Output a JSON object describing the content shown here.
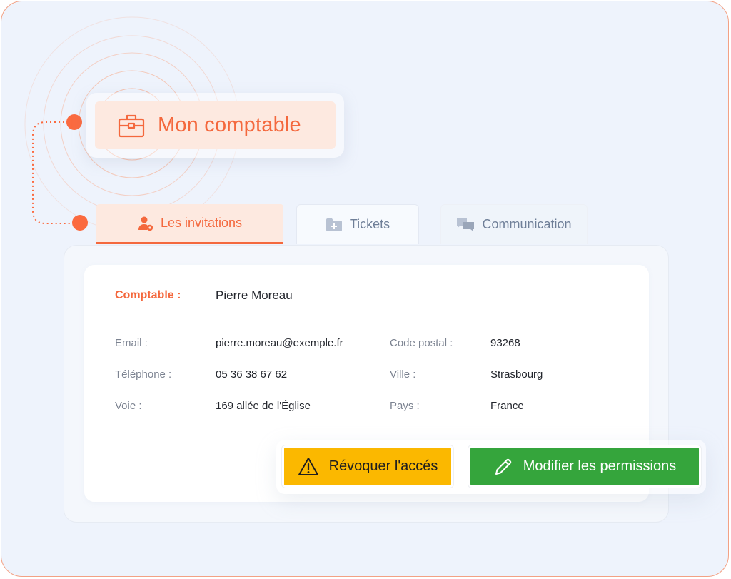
{
  "role": {
    "title": "Mon comptable",
    "icon": "briefcase-icon"
  },
  "tabs": [
    {
      "label": "Les invitations",
      "icon": "user-settings-icon",
      "active": true
    },
    {
      "label": "Tickets",
      "icon": "folder-add-icon",
      "active": false
    },
    {
      "label": "Communication",
      "icon": "chat-bubbles-icon",
      "active": false
    }
  ],
  "details": {
    "comptable_label": "Comptable :",
    "comptable_value": "Pierre Moreau",
    "fields": [
      {
        "label": "Email :",
        "value": "pierre.moreau@exemple.fr"
      },
      {
        "label": "Téléphone :",
        "value": "05 36 38 67 62"
      },
      {
        "label": "Voie :",
        "value": "169 allée de l'Église"
      },
      {
        "label": "Code postal :",
        "value": "93268"
      },
      {
        "label": "Ville :",
        "value": "Strasbourg"
      },
      {
        "label": "Pays :",
        "value": "France"
      }
    ]
  },
  "actions": {
    "revoke_label": "Révoquer l'accés",
    "modify_label": "Modifier les permissions"
  },
  "colors": {
    "accent": "#f4683d",
    "accent_soft": "#fde9e0",
    "revoke": "#fbb800",
    "modify": "#35a53c",
    "background": "#eef3fc"
  }
}
